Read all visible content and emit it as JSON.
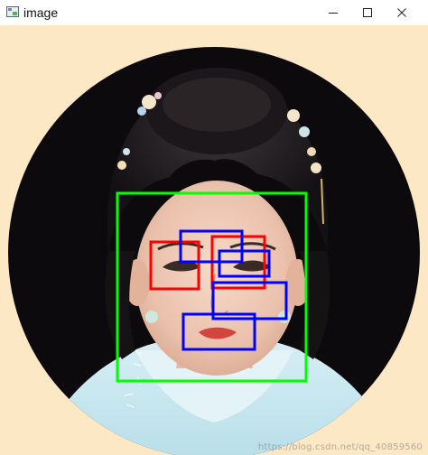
{
  "window": {
    "title": "image",
    "icon": "opencv-image-window-icon",
    "controls": [
      "minimize-icon",
      "maximize-icon",
      "close-icon"
    ]
  },
  "image": {
    "background_color": "#fde8c6",
    "face_box_color": "#00ff00",
    "eye_box_color": "#ff0000",
    "feature_box_color": "#0000ff",
    "detections": {
      "face_count": 1,
      "eye_count": 2,
      "feature_count": 4
    },
    "watermark": "https://blog.csdn.net/qq_40859560"
  }
}
